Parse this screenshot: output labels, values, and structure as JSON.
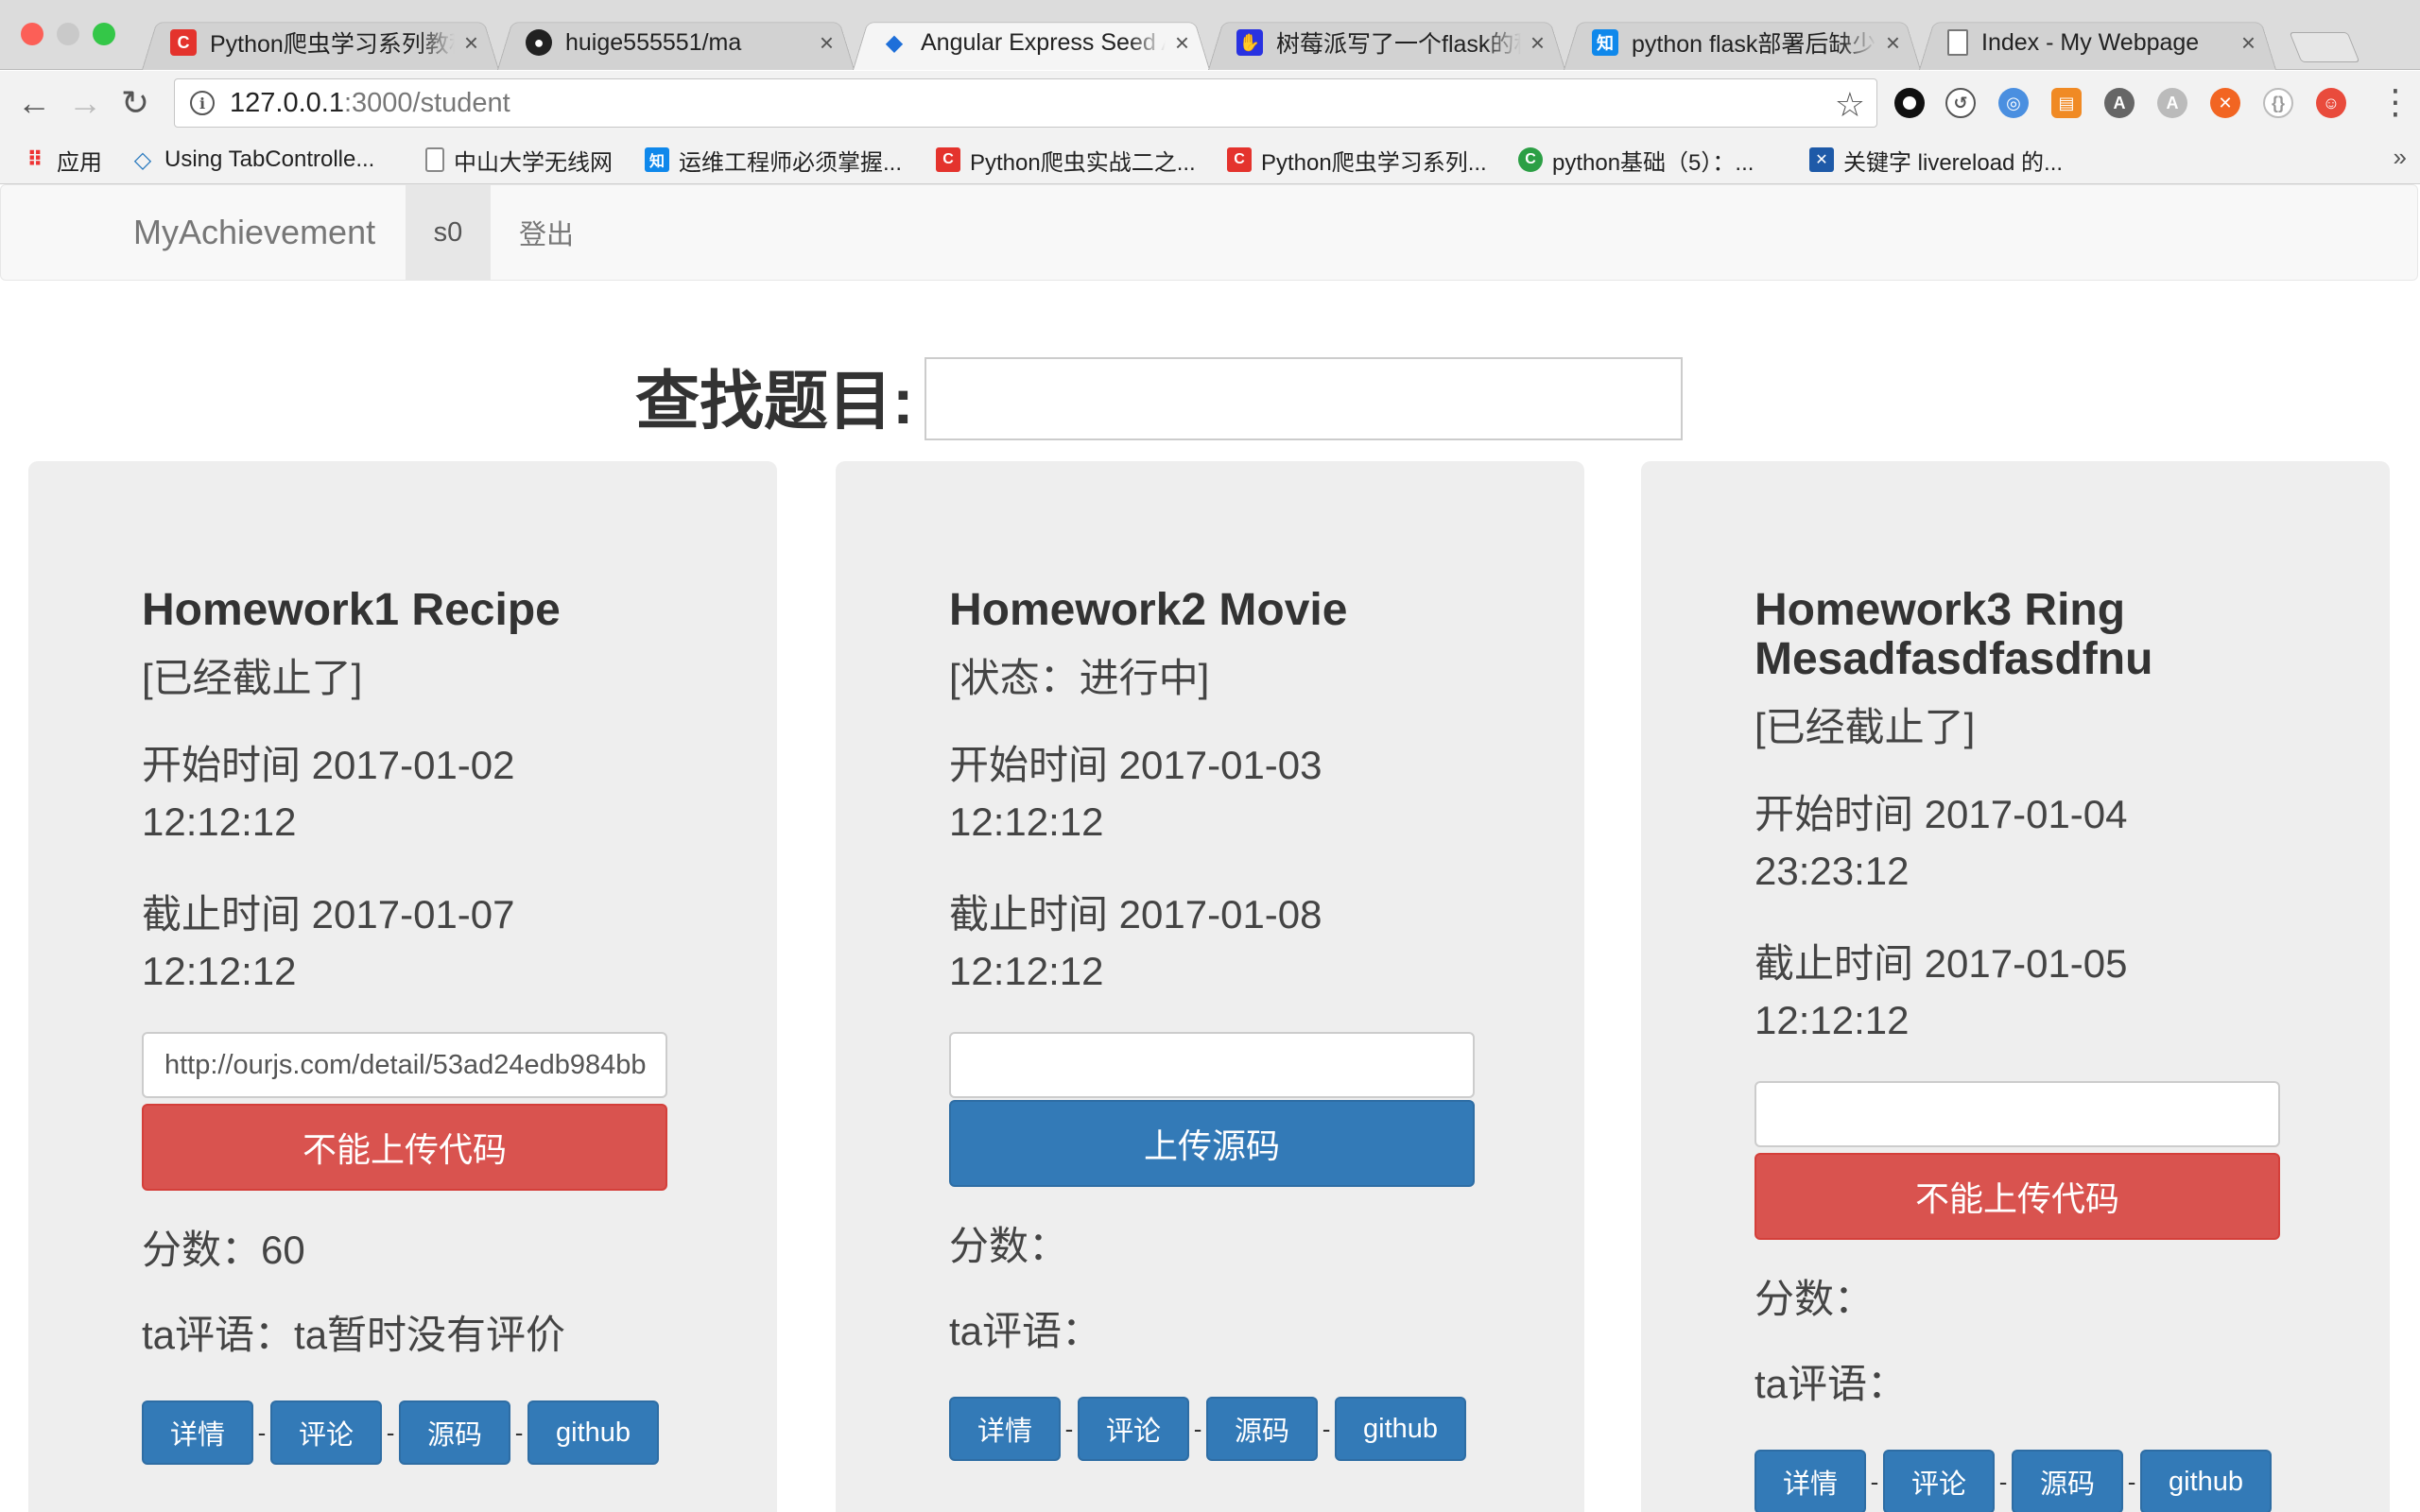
{
  "browser": {
    "tabs": [
      {
        "title": "Python爬虫学习系列教程",
        "icon": "csdn-icon"
      },
      {
        "title": "huige555551/ma",
        "icon": "github-icon"
      },
      {
        "title": "Angular Express Seed A",
        "icon": "angular-seed-icon"
      },
      {
        "title": "树莓派写了一个flask的程",
        "icon": "baidu-icon"
      },
      {
        "title": "python flask部署后缺少",
        "icon": "zhihu-icon"
      },
      {
        "title": "Index - My Webpage",
        "icon": "page-icon"
      }
    ],
    "close_glyph": "×",
    "url_host": "127.0.0.1",
    "url_path": ":3000/student",
    "bookmarks": [
      {
        "label": "应用"
      },
      {
        "label": "Using TabControlle..."
      },
      {
        "label": "中山大学无线网"
      },
      {
        "label": "运维工程师必须掌握..."
      },
      {
        "label": "Python爬虫实战二之..."
      },
      {
        "label": "Python爬虫学习系列..."
      },
      {
        "label": "python基础（5）：..."
      },
      {
        "label": "关键字 livereload 的..."
      }
    ],
    "more_glyph": "»"
  },
  "navbar": {
    "brand": "MyAchievement",
    "user": "s0",
    "logout": "登出"
  },
  "search": {
    "label": "查找题目:",
    "value": ""
  },
  "cards": [
    {
      "title": "Homework1 Recipe",
      "status": "[已经截止了]",
      "start": "开始时间 2017-01-02 12:12:12",
      "end": "截止时间 2017-01-07 12:12:12",
      "code_value": "http://ourjs.com/detail/53ad24edb984bb",
      "button": "不能上传代码",
      "score": "分数：60",
      "comment": "ta评语：ta暂时没有评价",
      "links": [
        "详情",
        "评论",
        "源码",
        "github"
      ]
    },
    {
      "title": "Homework2 Movie",
      "status": "[状态：进行中]",
      "start": "开始时间 2017-01-03 12:12:12",
      "end": "截止时间 2017-01-08 12:12:12",
      "code_value": "",
      "button": "上传源码",
      "score": "分数：",
      "comment": "ta评语：",
      "links": [
        "详情",
        "评论",
        "源码",
        "github"
      ]
    },
    {
      "title": "Homework3 Ring Mesadfasdfasdfnu",
      "status": "[已经截止了]",
      "start": "开始时间 2017-01-04 23:23:12",
      "end": "截止时间 2017-01-05 12:12:12",
      "code_value": "",
      "button": "不能上传代码",
      "score": "分数：",
      "comment": "ta评语：",
      "links": [
        "详情",
        "评论",
        "源码",
        "github"
      ]
    }
  ],
  "link_separator": "-",
  "colors": {
    "danger": "#d9534f",
    "primary": "#337ab7",
    "card_bg": "#eeeeee"
  }
}
